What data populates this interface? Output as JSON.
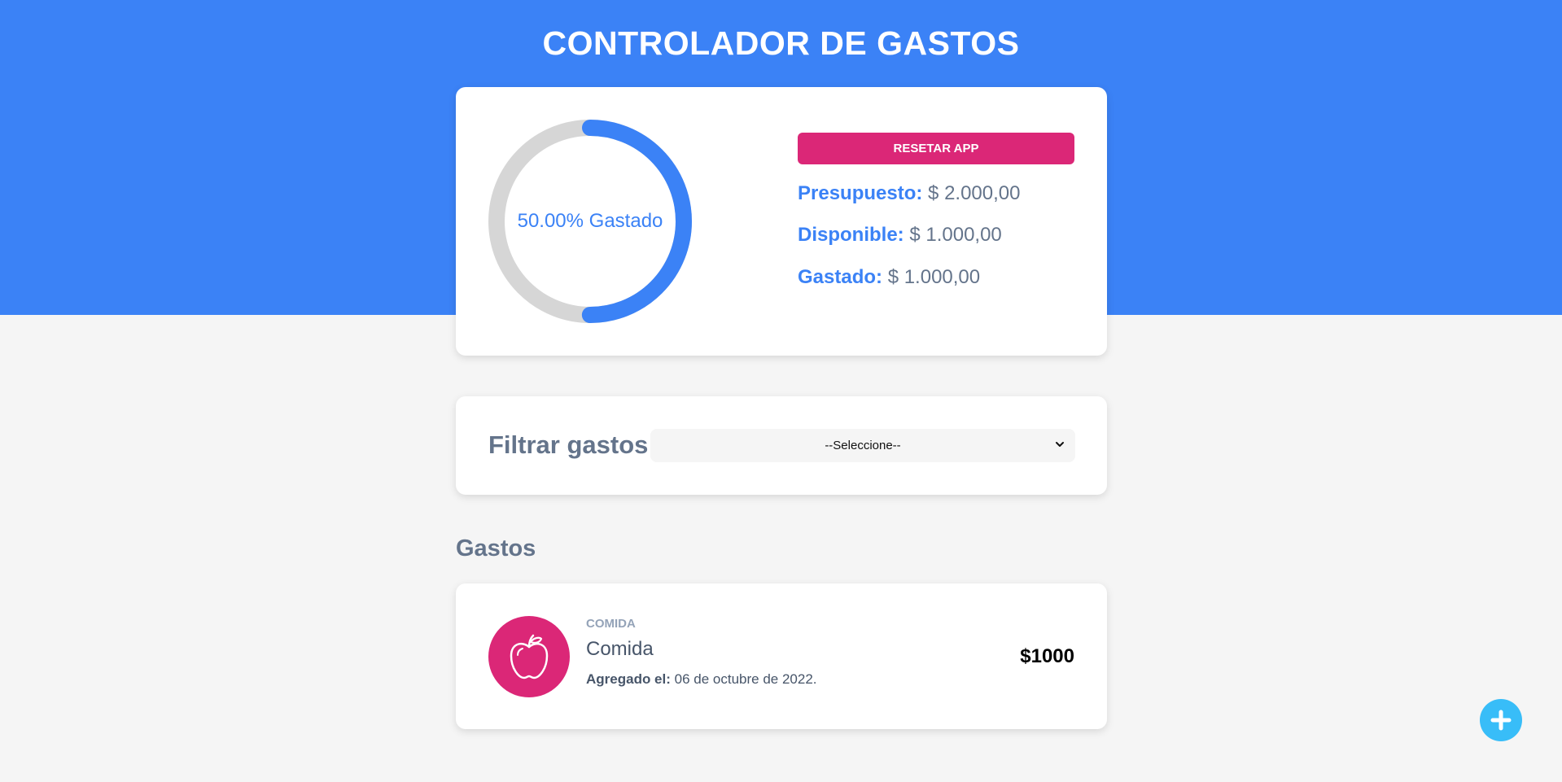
{
  "header": {
    "title": "CONTROLADOR DE GASTOS"
  },
  "budget": {
    "percent_spent": 50.0,
    "progress_label": "50.00% Gastado",
    "reset_label": "RESETAR APP",
    "budget_label": "Presupuesto:",
    "budget_value": "$ 2.000,00",
    "available_label": "Disponible:",
    "available_value": "$ 1.000,00",
    "spent_label": "Gastado:",
    "spent_value": "$ 1.000,00"
  },
  "filter": {
    "label": "Filtrar gastos",
    "selected": "--Seleccione--"
  },
  "expenses": {
    "title": "Gastos",
    "items": [
      {
        "category": "COMIDA",
        "name": "Comida",
        "date_label": "Agregado el:",
        "date_value": "06 de octubre de 2022.",
        "amount": "$1000",
        "icon": "apple-icon"
      }
    ]
  },
  "colors": {
    "primary": "#3b82f6",
    "accent": "#db2777",
    "add_button": "#38bdf8",
    "track": "#d6d6d6",
    "background": "#f5f5f5"
  },
  "add_button": {
    "icon": "plus-icon"
  }
}
